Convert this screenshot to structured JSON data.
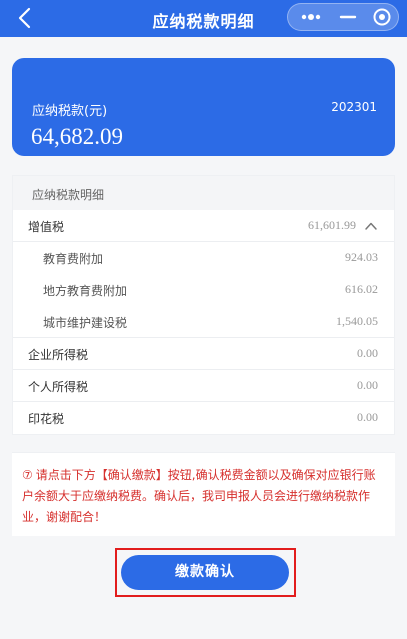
{
  "navbar": {
    "title": "应纳税款明细",
    "back_icon": "chevron-left-icon"
  },
  "summary": {
    "label": "应纳税款(元)",
    "period": "202301",
    "amount": "64,682.09"
  },
  "details": {
    "header": "应纳税款明细",
    "vat": {
      "label": "增值税",
      "value": "61,601.99",
      "sub_items": [
        {
          "label": "教育费附加",
          "value": "924.03"
        },
        {
          "label": "地方教育费附加",
          "value": "616.02"
        },
        {
          "label": "城市维护建设税",
          "value": "1,540.05"
        }
      ]
    },
    "items": [
      {
        "label": "企业所得税",
        "value": "0.00"
      },
      {
        "label": "个人所得税",
        "value": "0.00"
      },
      {
        "label": "印花税",
        "value": "0.00"
      }
    ]
  },
  "notice": {
    "icon": "info-circle-icon",
    "text": "请点击下方【确认缴款】按钮,确认税费金额以及确保对应银行账户余额大于应缴纳税费。确认后，我司申报人员会进行缴纳税款作业，谢谢配合！"
  },
  "action": {
    "confirm_label": "缴款确认"
  },
  "colors": {
    "brand": "#2c6be6",
    "notice": "#d6302d",
    "highlight": "#e21d1d"
  }
}
